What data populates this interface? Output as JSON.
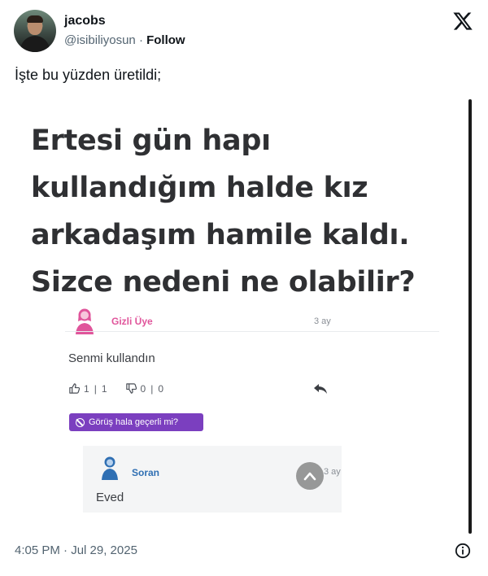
{
  "author": {
    "name": "jacobs",
    "handle": "@isibiliyosun",
    "separator": "·",
    "follow_label": "Follow"
  },
  "tweet": {
    "text": "İşte bu yüzden üretildi;",
    "timestamp": "4:05 PM · Jul 29, 2025"
  },
  "media": {
    "question_title": "Ertesi gün hapı kullandığım halde kız arkadaşım hamile kaldı. Sizce nedeni ne olabilir?",
    "answer": {
      "user": "Gizli Üye",
      "time": "3 ay",
      "text": "Senmi kullandın",
      "likes": "1",
      "likes_total": "1",
      "dislikes": "0",
      "dislikes_total": "0",
      "badge_label": "Görüş hala geçerli mi?"
    },
    "reply": {
      "user": "Soran",
      "time": "3 ay",
      "text": "Eved"
    }
  },
  "colors": {
    "anonymous_user": "#e0559b",
    "asker_user": "#2f6fb3",
    "badge_bg": "#7b3fbf",
    "secondary_text": "#536471"
  },
  "icons": {
    "logo": "x-logo-icon",
    "like": "thumbs-up-icon",
    "dislike": "thumbs-down-icon",
    "reply": "reply-arrow-icon",
    "scroll_top": "chevron-up-icon",
    "info": "info-icon"
  }
}
